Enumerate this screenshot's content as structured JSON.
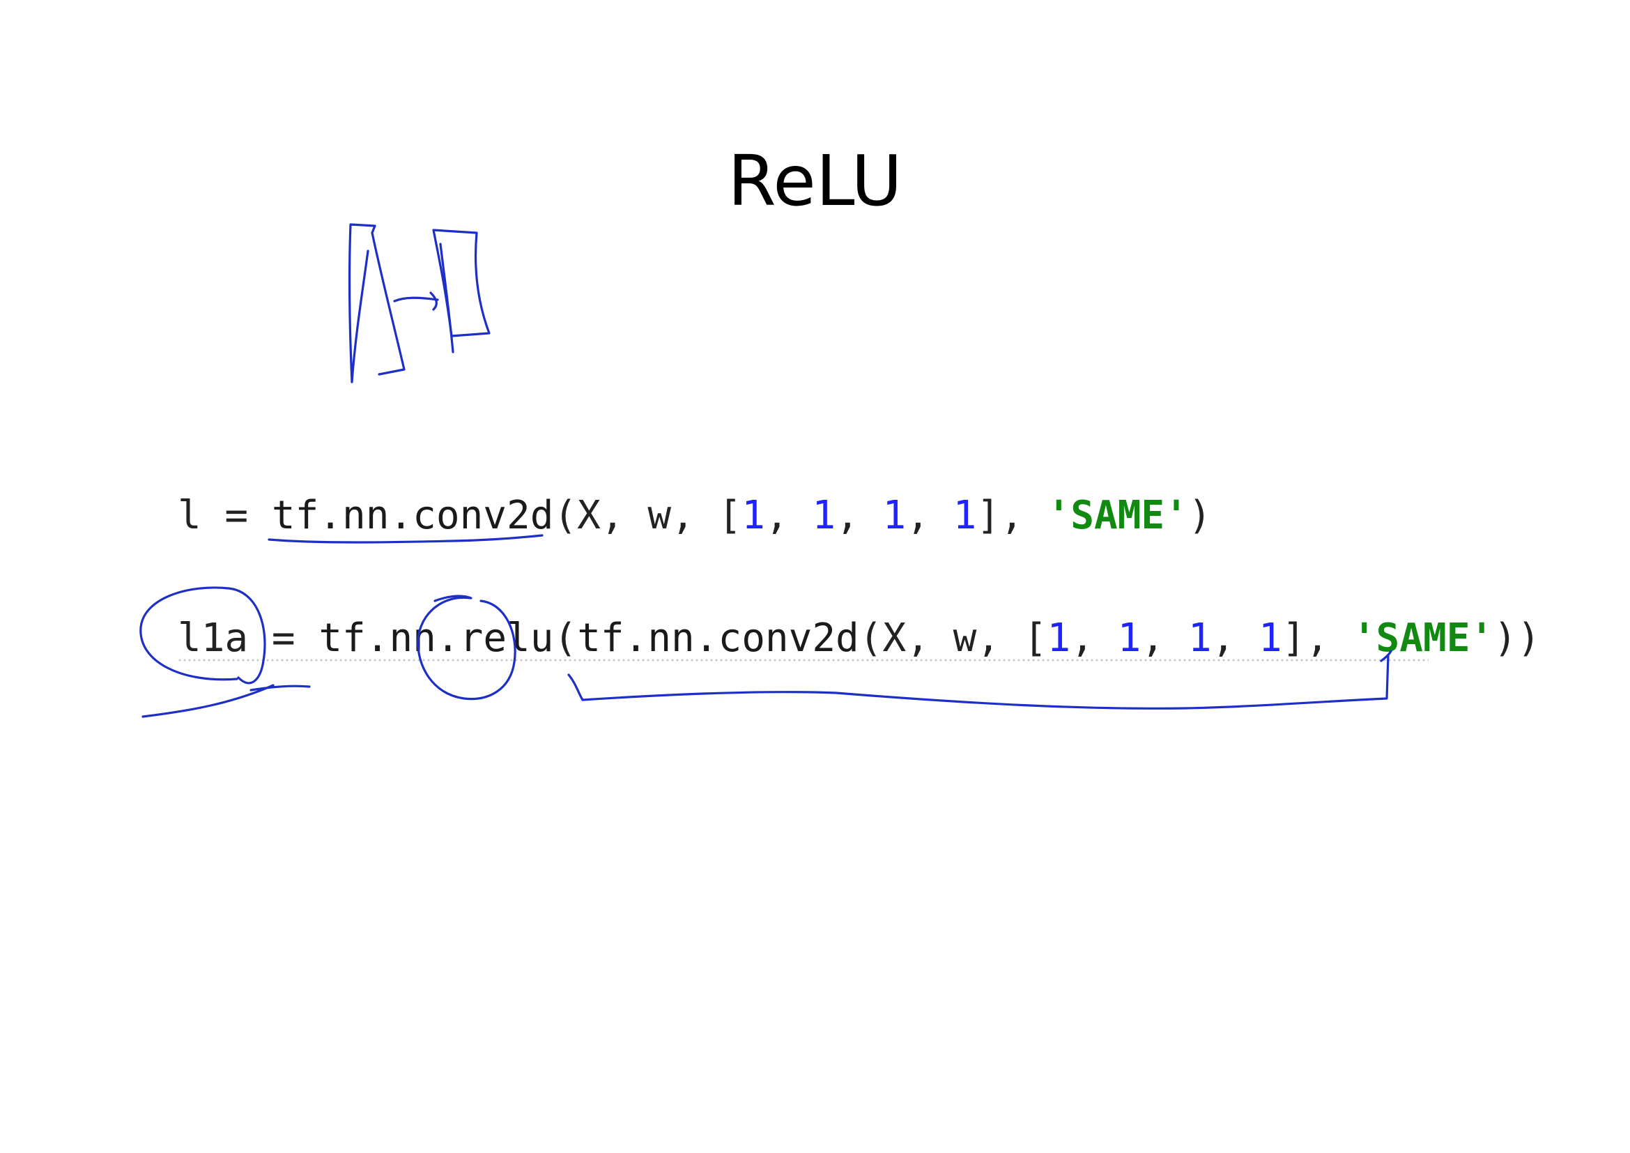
{
  "slide": {
    "title": "ReLU",
    "code": {
      "line1": {
        "var": "l",
        "assign": " = ",
        "func": "tf.nn.conv2d",
        "open": "(",
        "args": "X, w, [",
        "n1": "1",
        "sep1": ", ",
        "n2": "1",
        "sep2": ", ",
        "n3": "1",
        "sep3": ", ",
        "n4": "1",
        "close_list": "], ",
        "str": "'SAME'",
        "close": ")"
      },
      "line2": {
        "var": "l1a",
        "assign": " = ",
        "func_outer": "tf.nn.relu",
        "open_outer": "(",
        "func_inner": "tf.nn.conv2d",
        "open": "(",
        "args": "X, w, [",
        "n1": "1",
        "sep1": ", ",
        "n2": "1",
        "sep2": ", ",
        "n3": "1",
        "sep3": ", ",
        "n4": "1",
        "close_list": "], ",
        "str": "'SAME'",
        "close": "))"
      }
    },
    "colors": {
      "number": "#1f23ff",
      "string": "#128a12",
      "ink": "#1e2fc8"
    },
    "annotations": [
      "two-layer-sketch",
      "conv2d-underline",
      "l1a-circle",
      "relu-circle",
      "conv2d-bracket"
    ]
  }
}
